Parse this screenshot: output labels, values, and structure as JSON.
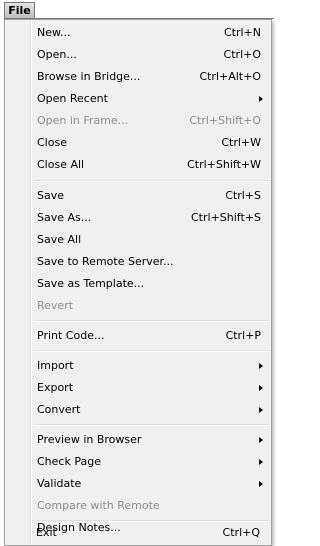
{
  "menubar": {
    "title": "File"
  },
  "menu": {
    "items": [
      {
        "label": "New...",
        "shortcut": "Ctrl+N"
      },
      {
        "label": "Open...",
        "shortcut": "Ctrl+O"
      },
      {
        "label": "Browse in Bridge...",
        "shortcut": "Ctrl+Alt+O"
      },
      {
        "label": "Open Recent",
        "shortcut": ""
      },
      {
        "label": "Open in Frame...",
        "shortcut": "Ctrl+Shift+O"
      },
      {
        "label": "Close",
        "shortcut": "Ctrl+W"
      },
      {
        "label": "Close All",
        "shortcut": "Ctrl+Shift+W"
      },
      {
        "label": "Save",
        "shortcut": "Ctrl+S"
      },
      {
        "label": "Save As...",
        "shortcut": "Ctrl+Shift+S"
      },
      {
        "label": "Save All",
        "shortcut": ""
      },
      {
        "label": "Save to Remote Server...",
        "shortcut": ""
      },
      {
        "label": "Save as Template...",
        "shortcut": ""
      },
      {
        "label": "Revert",
        "shortcut": ""
      },
      {
        "label": "Print Code...",
        "shortcut": "Ctrl+P"
      },
      {
        "label": "Import",
        "shortcut": ""
      },
      {
        "label": "Export",
        "shortcut": ""
      },
      {
        "label": "Convert",
        "shortcut": ""
      },
      {
        "label": "Preview in Browser",
        "shortcut": ""
      },
      {
        "label": "Check Page",
        "shortcut": ""
      },
      {
        "label": "Validate",
        "shortcut": ""
      },
      {
        "label": "Compare with Remote",
        "shortcut": ""
      },
      {
        "label": "Design Notes...",
        "shortcut": ""
      },
      {
        "label": "Exit",
        "shortcut": "Ctrl+Q"
      }
    ]
  },
  "colors": {
    "menu_bg": "#f0f0f0",
    "disabled_text": "#8d8d8d",
    "border": "#a0a0a0"
  }
}
